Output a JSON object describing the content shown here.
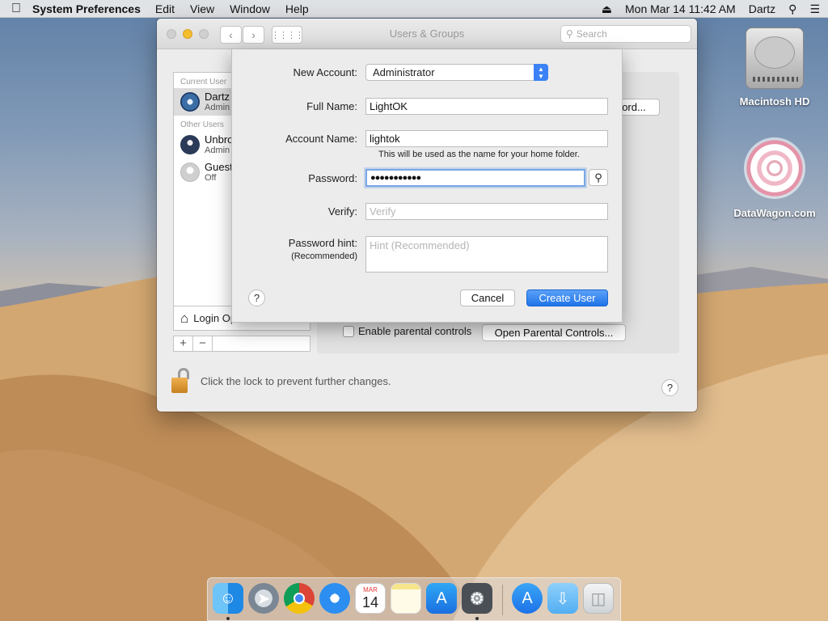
{
  "menubar": {
    "app_name": "System Preferences",
    "menus": [
      "Edit",
      "View",
      "Window",
      "Help"
    ],
    "datetime": "Mon Mar 14  11:42 AM",
    "user": "Dartz"
  },
  "desktop": {
    "icons": [
      {
        "label": "Macintosh HD",
        "icon": "hard-drive-icon"
      },
      {
        "label": "DataWagon.com",
        "icon": "datawagon-logo-icon"
      }
    ]
  },
  "window": {
    "title": "Users & Groups",
    "search_placeholder": "Search",
    "sections": {
      "current": "Current User",
      "other": "Other Users"
    },
    "users": [
      {
        "name": "Dartz",
        "role": "Admin",
        "selected": true
      },
      {
        "name": "Unbro",
        "role": "Admin",
        "selected": false
      },
      {
        "name": "Guest",
        "role": "Off",
        "selected": false
      }
    ],
    "login_options": "Login Options",
    "change_password_btn": "ord...",
    "parental_checkbox": "Enable parental controls",
    "parental_button": "Open Parental Controls...",
    "lock_text": "Click the lock to prevent further changes.",
    "help": "?"
  },
  "sheet": {
    "new_account_label": "New Account:",
    "new_account_value": "Administrator",
    "full_name_label": "Full Name:",
    "full_name_value": "LightOK",
    "account_name_label": "Account Name:",
    "account_name_value": "lightok",
    "account_name_hint": "This will be used as the name for your home folder.",
    "password_label": "Password:",
    "password_value": "●●●●●●●●●●●",
    "verify_label": "Verify:",
    "verify_placeholder": "Verify",
    "hint_label": "Password hint:",
    "hint_sublabel": "(Recommended)",
    "hint_placeholder": "Hint (Recommended)",
    "help": "?",
    "cancel": "Cancel",
    "create": "Create User"
  },
  "dock": {
    "apps": [
      "Finder",
      "Launchpad",
      "Chrome",
      "Safari",
      "Calendar",
      "Notes",
      "App Store",
      "System Preferences",
      "App Store Downloads",
      "Downloads",
      "Trash"
    ],
    "calendar_month": "MAR",
    "calendar_day": "14"
  }
}
